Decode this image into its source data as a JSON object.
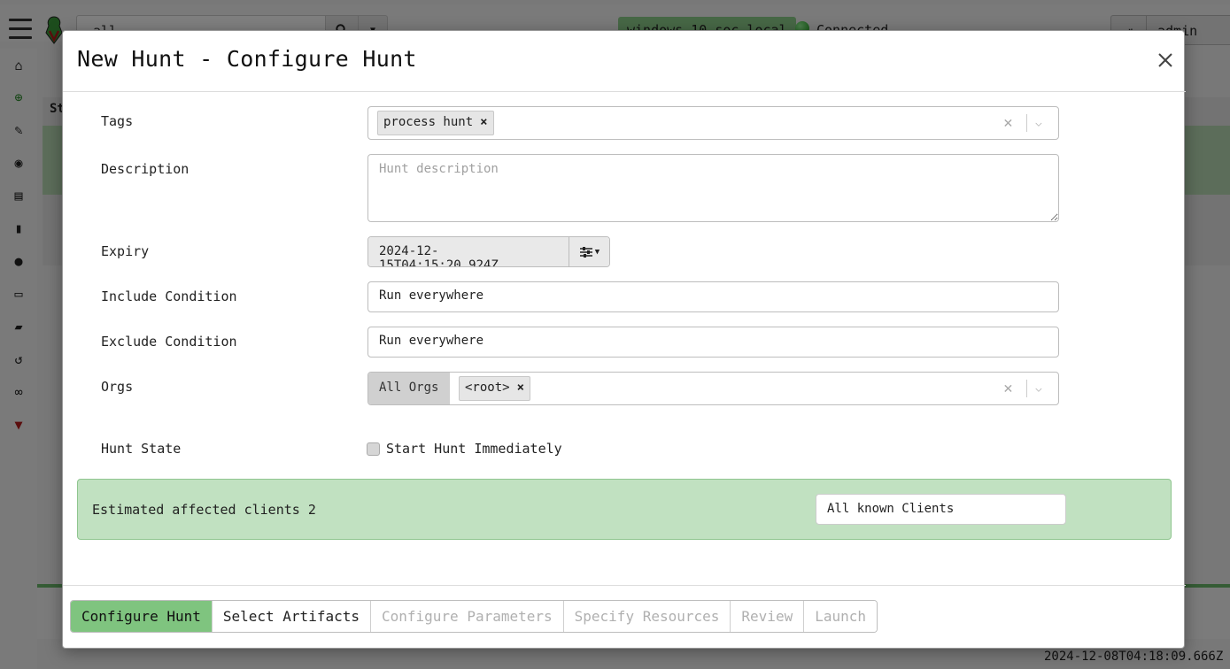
{
  "background": {
    "search_value": "all",
    "search_icon": "search-icon",
    "client_name": "windows-10.soc.local",
    "connection_status": "Connected",
    "username": "admin",
    "panel_header": "St",
    "footer_timestamp": "2024-12-08T04:18:09.666Z",
    "sidebar_icons": [
      "home-icon",
      "crosshairs-icon",
      "wrench-icon",
      "eye-icon",
      "server-icon",
      "book-icon",
      "user-icon",
      "laptop-icon",
      "folder-open-icon",
      "history-icon",
      "binoculars-icon",
      "velociraptor-icon"
    ]
  },
  "modal": {
    "title": "New Hunt - Configure Hunt",
    "close_icon": "close-icon",
    "form": {
      "tags_label": "Tags",
      "tags": [
        "process hunt"
      ],
      "tag_remove": "×",
      "description_label": "Description",
      "description_placeholder": "Hunt description",
      "description_value": "",
      "expiry_label": "Expiry",
      "expiry_value": "2024-12-15T04:15:20.924Z",
      "include_label": "Include Condition",
      "include_value": "Run everywhere",
      "exclude_label": "Exclude Condition",
      "exclude_value": "Run everywhere",
      "orgs_label": "Orgs",
      "orgs_prefix": "All Orgs",
      "orgs": [
        "<root>"
      ],
      "hunt_state_label": "Hunt State",
      "start_immediately_label": "Start Hunt Immediately",
      "start_immediately_checked": false
    },
    "estimate": {
      "text": "Estimated affected clients 2",
      "scope": "All known Clients"
    },
    "steps": [
      {
        "label": "Configure Hunt",
        "state": "active"
      },
      {
        "label": "Select Artifacts",
        "state": "enabled"
      },
      {
        "label": "Configure Parameters",
        "state": "disabled"
      },
      {
        "label": "Specify Resources",
        "state": "disabled"
      },
      {
        "label": "Review",
        "state": "disabled"
      },
      {
        "label": "Launch",
        "state": "disabled"
      }
    ]
  },
  "colors": {
    "accent_green": "#7fc47f",
    "estimate_bg": "#c1e1c1",
    "brand_red": "#b71c1c"
  }
}
